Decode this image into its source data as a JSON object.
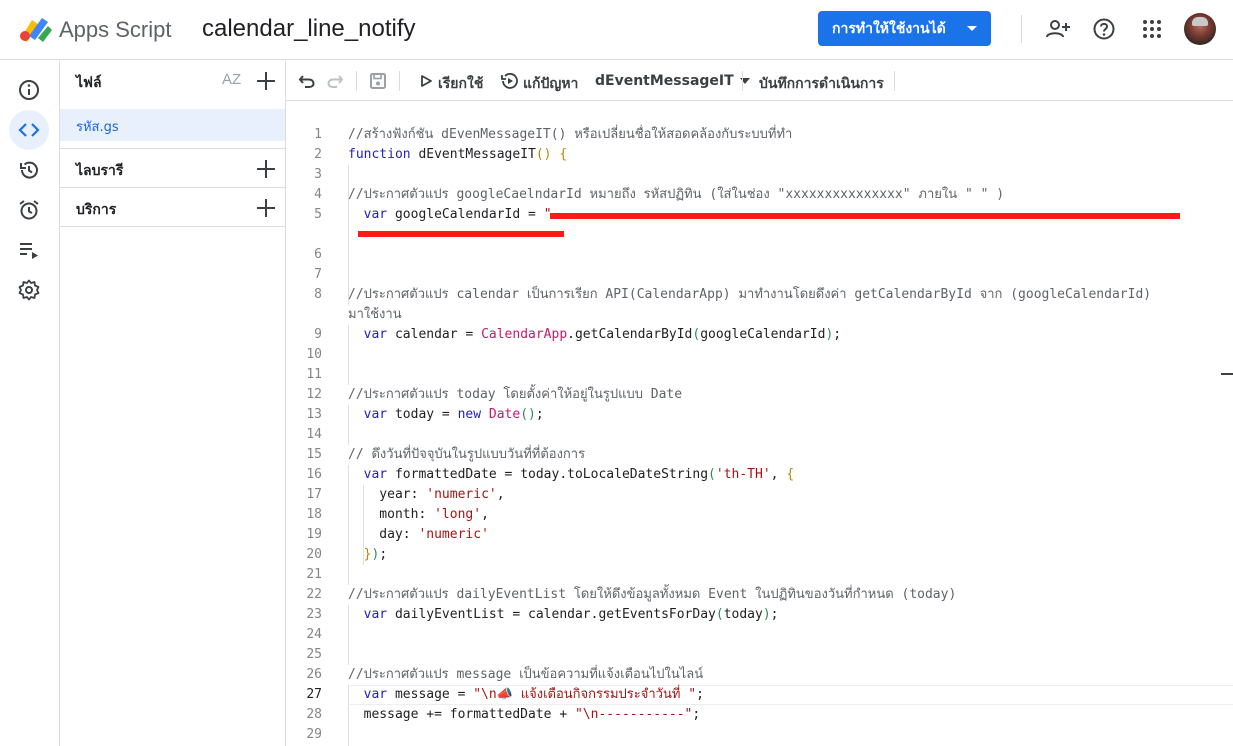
{
  "header": {
    "brand": "Apps Script",
    "project_title": "calendar_line_notify",
    "deploy_label": "การทำให้ใช้งานได้"
  },
  "files_panel": {
    "title": "ไฟล์",
    "sort_label": "AZ",
    "selected_file": "รหัส.gs",
    "sections": [
      "ไลบรารี",
      "บริการ"
    ]
  },
  "toolbar": {
    "run_label": "เรียกใช้",
    "debug_label": "แก้ปัญหา",
    "function_name": "dEventMessageIT",
    "log_label": "บันทึกการดำเนินการ"
  },
  "colors": {
    "accent": "#1a73e8",
    "selected_bg": "#e8f0fe",
    "redaction": "#ff1a1a"
  },
  "editor": {
    "current_line": 27,
    "line_numbers": [
      "1",
      "2",
      "3",
      "4",
      "5",
      "6",
      "7",
      "8",
      "9",
      "10",
      "11",
      "12",
      "13",
      "14",
      "15",
      "16",
      "17",
      "18",
      "19",
      "20",
      "21",
      "22",
      "23",
      "24",
      "25",
      "26",
      "27",
      "28",
      "29"
    ],
    "lines": [
      [
        "//สร้างฟังก์ชัน dEvenMessageIT() หรือเปลี่ยนชื่อให้สอดคล้องกับระบบที่ทำ"
      ],
      [
        "function",
        " dEventMessageIT",
        "()",
        " {"
      ],
      [],
      [
        "//ประกาศตัวแปร googleCaelndarId หมายถึง รหัสปฏิทิน (ใส่ในช่อง \"xxxxxxxxxxxxxxx\" ภายใน \" \" )"
      ],
      [
        "  var",
        " googleCalendarId = ",
        "\""
      ],
      [],
      [],
      [
        "//ประกาศตัวแปร calendar เป็นการเรียก API(CalendarApp) มาทำงานโดยดึงค่า getCalendarById จาก (googleCalendarId)",
        "มาใช้งาน"
      ],
      [
        "  var",
        " calendar = ",
        "CalendarApp",
        ".getCalendarById",
        "(",
        "googleCalendarId",
        ")",
        ";"
      ],
      [],
      [],
      [
        "//ประกาศตัวแปร today โดยตั้งค่าให้อยู่ในรูปแบบ Date"
      ],
      [
        "  var",
        " today = ",
        "new",
        " ",
        "Date",
        "()",
        ";"
      ],
      [],
      [
        "// ดึงวันที่ปัจจุบันในรูปแบบวันที่ที่ต้องการ"
      ],
      [
        "  var",
        " formattedDate = today.toLocaleDateString",
        "(",
        "'th-TH'",
        ", ",
        "{"
      ],
      [
        "    year: ",
        "'numeric'",
        ","
      ],
      [
        "    month: ",
        "'long'",
        ","
      ],
      [
        "    day: ",
        "'numeric'"
      ],
      [
        "  ",
        "}",
        ")",
        ";"
      ],
      [],
      [
        "//ประกาศตัวแปร dailyEventList โดยให้ดึงข้อมูลทั้งหมด Event ในปฏิทินของวันที่กำหนด (today)"
      ],
      [
        "  var",
        " dailyEventList = calendar.getEventsForDay",
        "(",
        "today",
        ")",
        ";"
      ],
      [],
      [],
      [
        "//ประกาศตัวแปร message เป็นข้อความที่แจ้งเตือนไปในไลน์"
      ],
      [
        "  var",
        " message = ",
        "\"\\n📣 แจ้งเตือนกิจกรรมประจำวันที่ \"",
        ";"
      ],
      [
        "  message += formattedDate + ",
        "\"\\n-----------\"",
        ";"
      ],
      []
    ]
  }
}
